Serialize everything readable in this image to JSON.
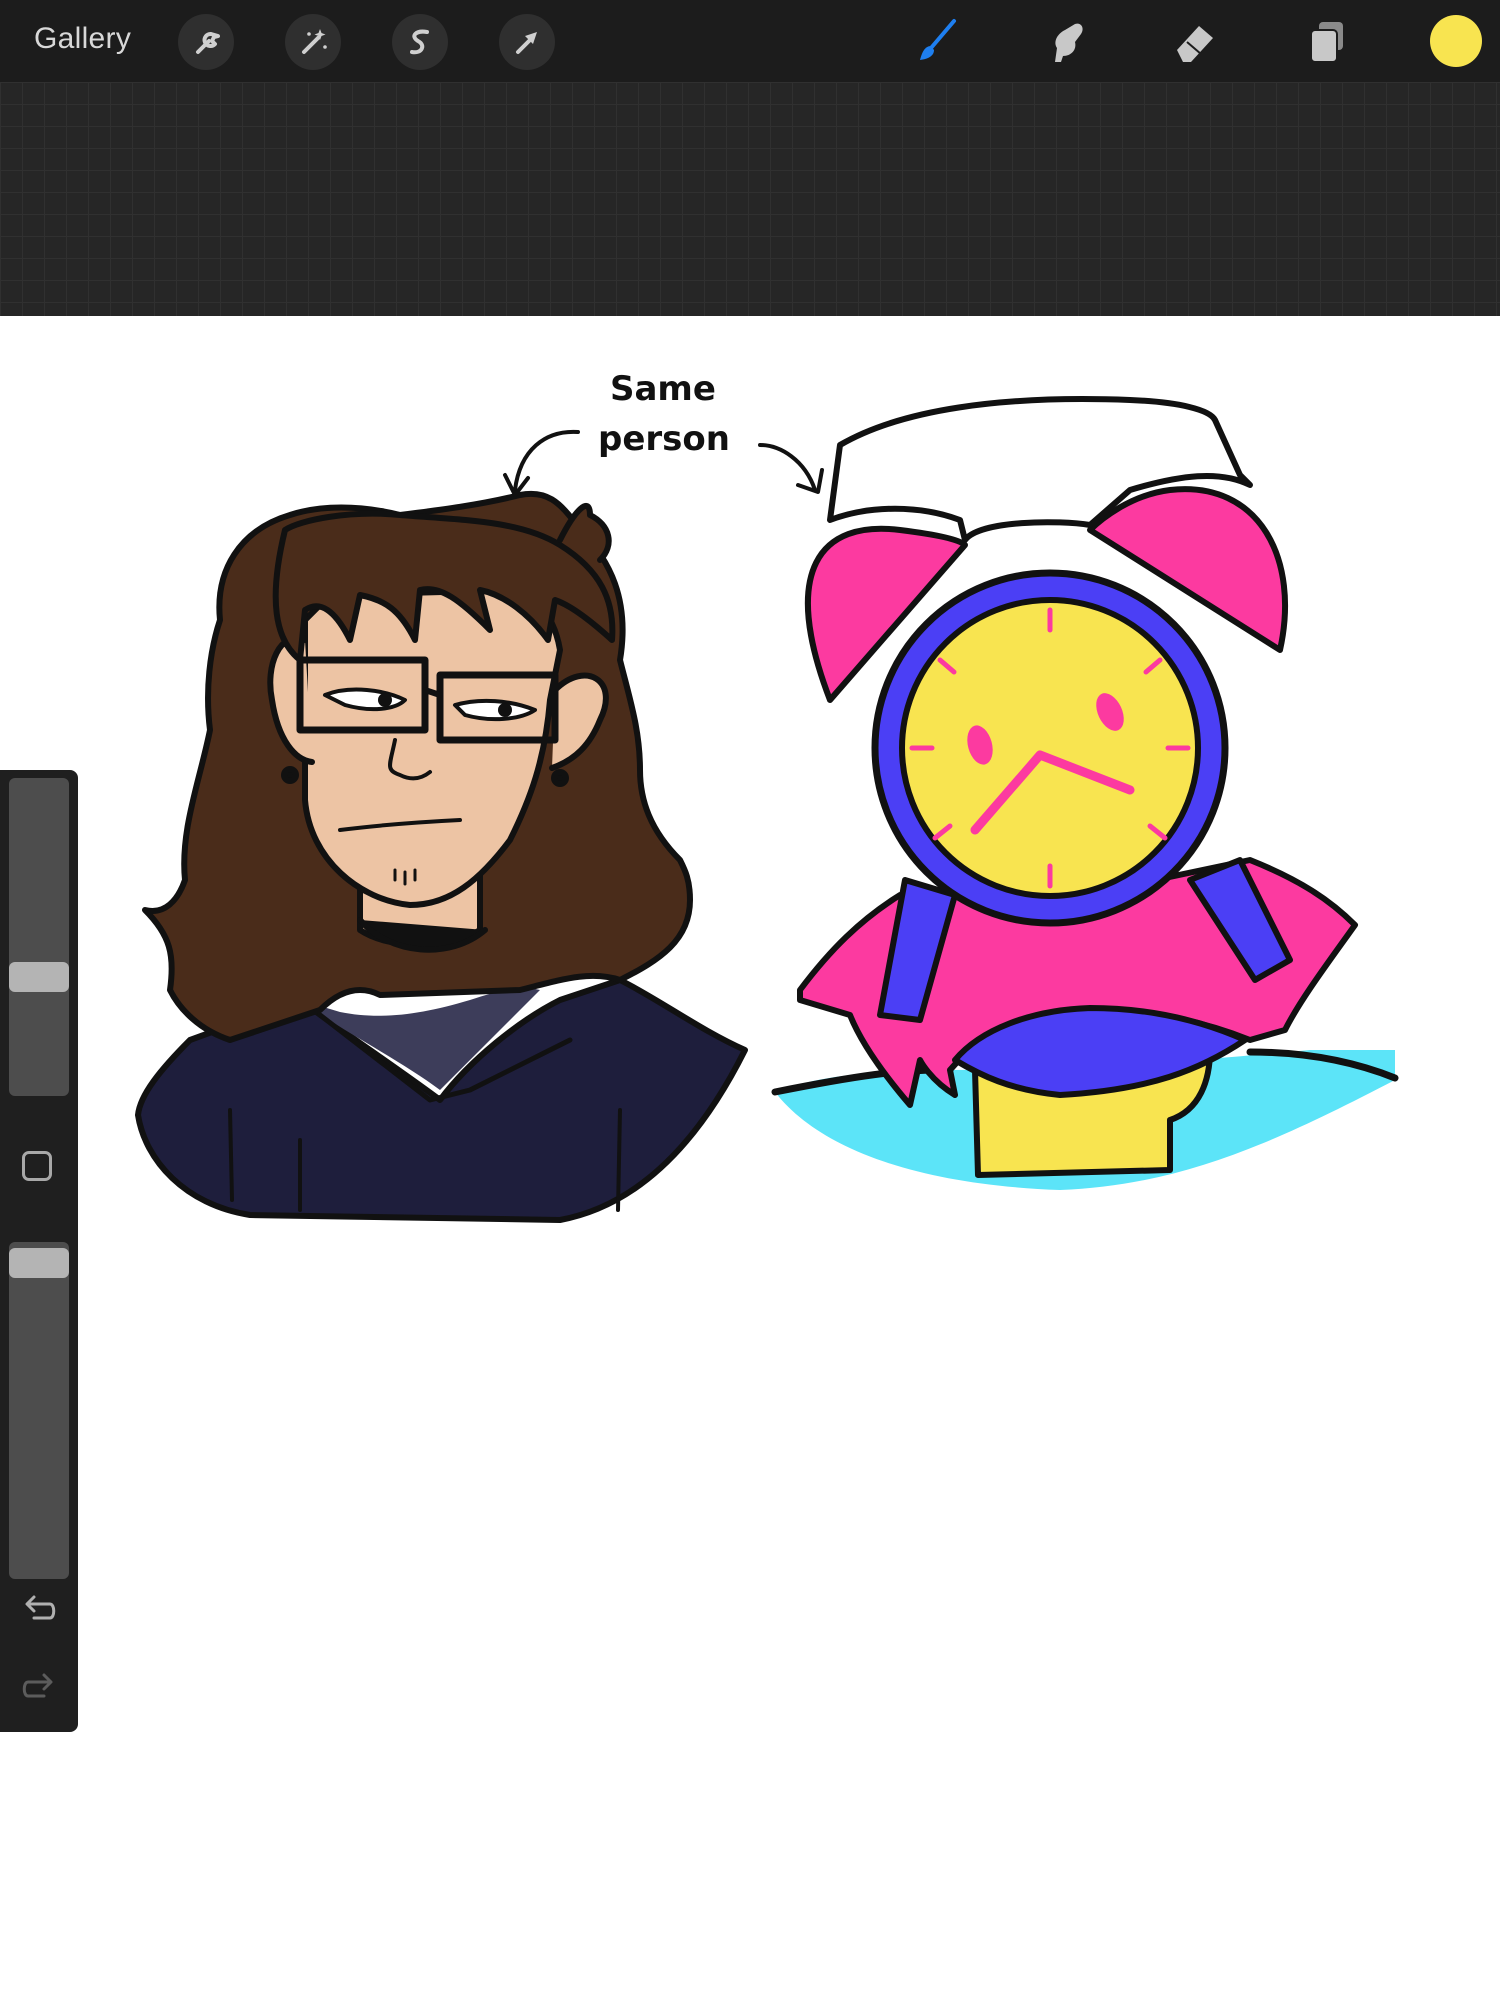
{
  "app": "Procreate",
  "toolbar": {
    "gallery_label": "Gallery",
    "left_tools": [
      {
        "name": "actions",
        "icon": "wrench-icon"
      },
      {
        "name": "adjustments",
        "icon": "magic-wand-icon"
      },
      {
        "name": "selection",
        "icon": "selection-s-icon"
      },
      {
        "name": "transform",
        "icon": "arrow-cursor-icon"
      }
    ],
    "right_tools": [
      {
        "name": "brush",
        "icon": "brush-icon",
        "active": true
      },
      {
        "name": "smudge",
        "icon": "smudge-finger-icon"
      },
      {
        "name": "eraser",
        "icon": "eraser-icon"
      },
      {
        "name": "layers",
        "icon": "layers-icon"
      }
    ],
    "current_color": "#f8e450",
    "active_tool_color": "#1e7ff0"
  },
  "sidebar": {
    "brush_size_level": 0.6,
    "opacity_level": 1.0,
    "modifier_icon": "square-modifier-icon",
    "undo_icon": "undo-icon",
    "redo_icon": "redo-icon"
  },
  "canvas": {
    "annotation_line1": "Same",
    "annotation_line2": "person",
    "palette": {
      "hair": "#4a2c1a",
      "skin": "#edc4a4",
      "hoodie": "#1e1e3c",
      "shirt": "#3d3d5a",
      "pink": "#fc3aa0",
      "blue": "#4b3ff5",
      "yellow": "#f8e450",
      "cyan": "#5ce4f8"
    }
  }
}
